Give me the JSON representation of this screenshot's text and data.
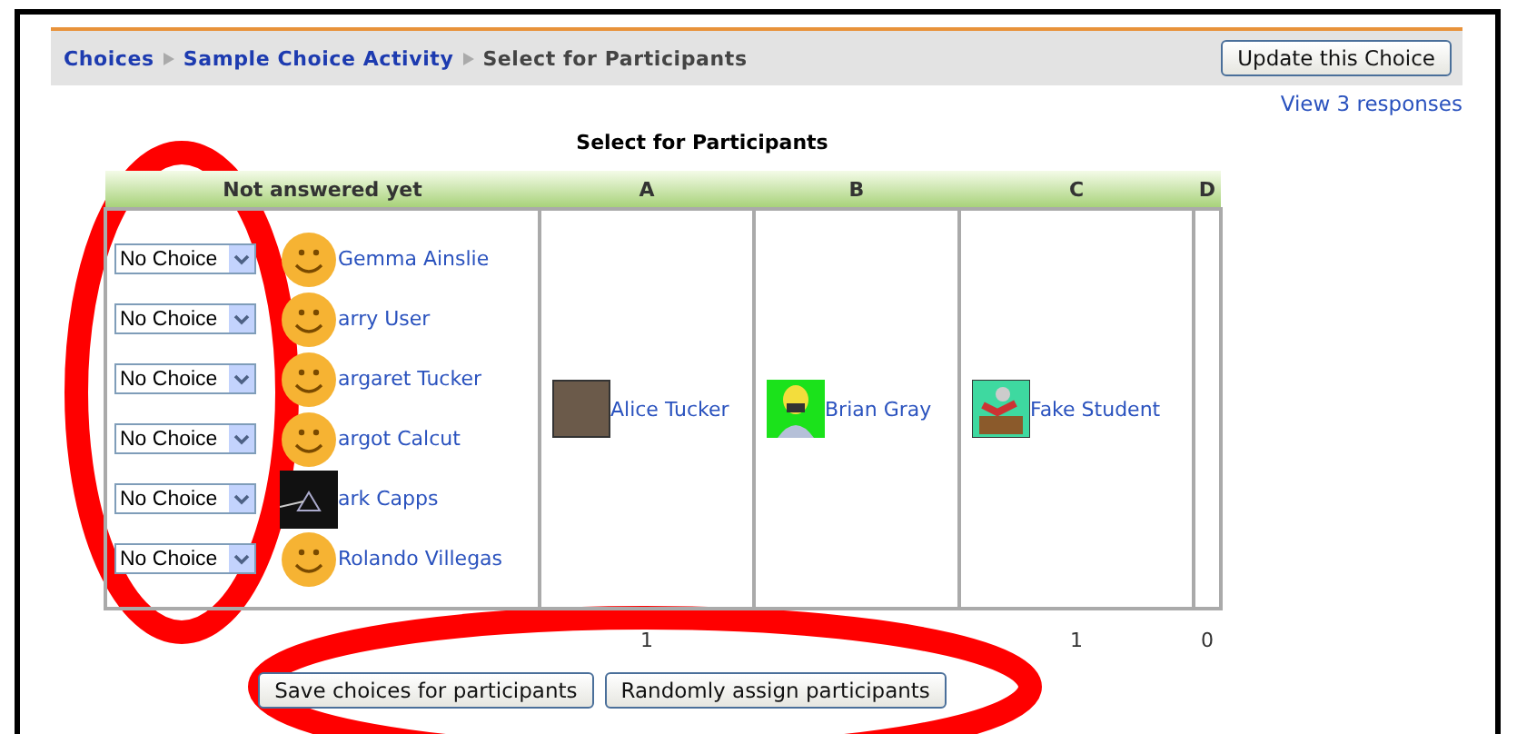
{
  "breadcrumb": [
    {
      "label": "Choices",
      "link": true
    },
    {
      "label": "Sample Choice Activity",
      "link": true
    },
    {
      "label": "Select for Participants",
      "link": false
    }
  ],
  "update_button": "Update this Choice",
  "responses_link": "View 3 responses",
  "title": "Select for Participants",
  "columns": [
    {
      "heading": "Not answered yet",
      "participants": [
        {
          "choice": "No Choice",
          "kind": "smiley",
          "name": "Gemma Ainslie"
        },
        {
          "choice": "No Choice",
          "kind": "smiley",
          "name": "arry User"
        },
        {
          "choice": "No Choice",
          "kind": "smiley",
          "name": "argaret Tucker"
        },
        {
          "choice": "No Choice",
          "kind": "smiley",
          "name": "argot Calcut"
        },
        {
          "choice": "No Choice",
          "kind": "dark",
          "name": "ark Capps"
        },
        {
          "choice": "No Choice",
          "kind": "smiley",
          "name": "Rolando Villegas"
        }
      ]
    },
    {
      "heading": "A",
      "count": "1",
      "participants": [
        {
          "kind": "photo",
          "name": "Alice Tucker"
        }
      ]
    },
    {
      "heading": "B",
      "participants": [
        {
          "kind": "cartoon-man",
          "name": "Brian Gray"
        }
      ]
    },
    {
      "heading": "C",
      "count": "1",
      "participants": [
        {
          "kind": "cartoon-scene",
          "name": "Fake Student"
        }
      ]
    },
    {
      "heading": "D",
      "count": "0"
    }
  ],
  "buttons": [
    "Save choices for participants",
    "Randomly assign participants"
  ]
}
